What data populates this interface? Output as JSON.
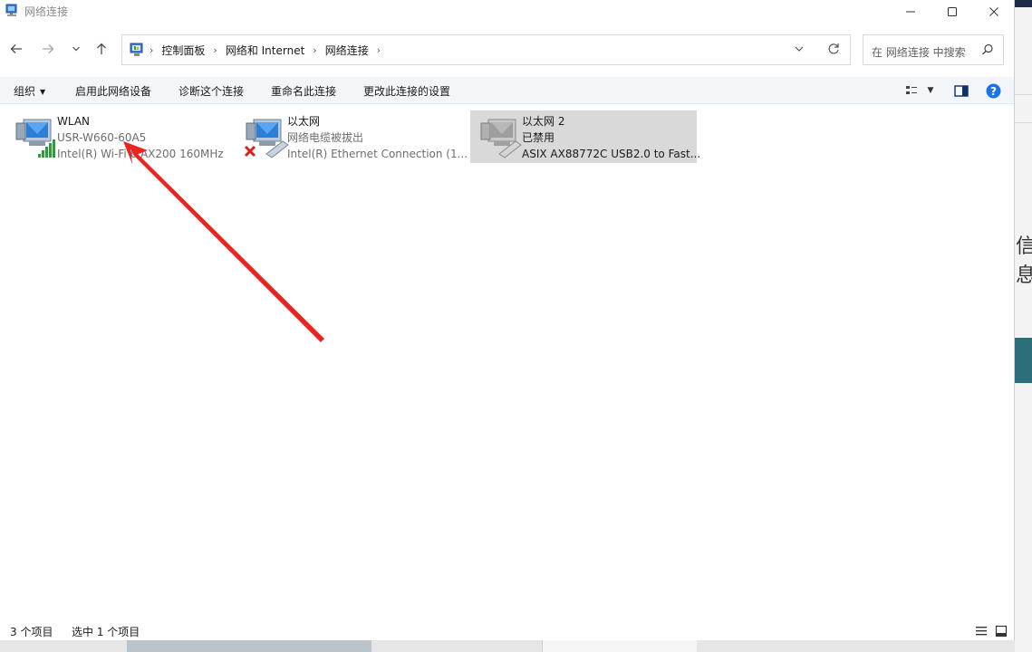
{
  "window": {
    "title": "网络连接",
    "controls": {
      "minimize": "minimize-icon",
      "maximize": "maximize-icon",
      "close": "close-icon"
    }
  },
  "nav": {
    "breadcrumb": [
      "控制面板",
      "网络和 Internet",
      "网络连接"
    ],
    "search_placeholder": "在 网络连接 中搜索"
  },
  "commands": {
    "organize": "组织",
    "enable": "启用此网络设备",
    "diagnose": "诊断这个连接",
    "rename": "重命名此连接",
    "change": "更改此连接的设置"
  },
  "connections": [
    {
      "name": "WLAN",
      "status": "USR-W660-60A5",
      "device": "Intel(R) Wi-Fi 6 AX200 160MHz",
      "icon": "wifi-adapter-icon",
      "selected": false
    },
    {
      "name": "以太网",
      "status": "网络电缆被拔出",
      "device": "Intel(R) Ethernet Connection (1...",
      "icon": "ethernet-unplugged-icon",
      "selected": false
    },
    {
      "name": "以太网 2",
      "status": "已禁用",
      "device": "ASIX AX88772C USB2.0 to Fast...",
      "icon": "ethernet-disabled-icon",
      "selected": true
    }
  ],
  "statusbar": {
    "count": "3 个项目",
    "selected": "选中 1 个项目"
  },
  "colors": {
    "annotation_arrow": "#e8261f",
    "help": "#1a73e8",
    "command_bar": "#f3f6f9",
    "selection": "#d9d9d9"
  },
  "background_text": {
    "right_glyph": "信息"
  }
}
